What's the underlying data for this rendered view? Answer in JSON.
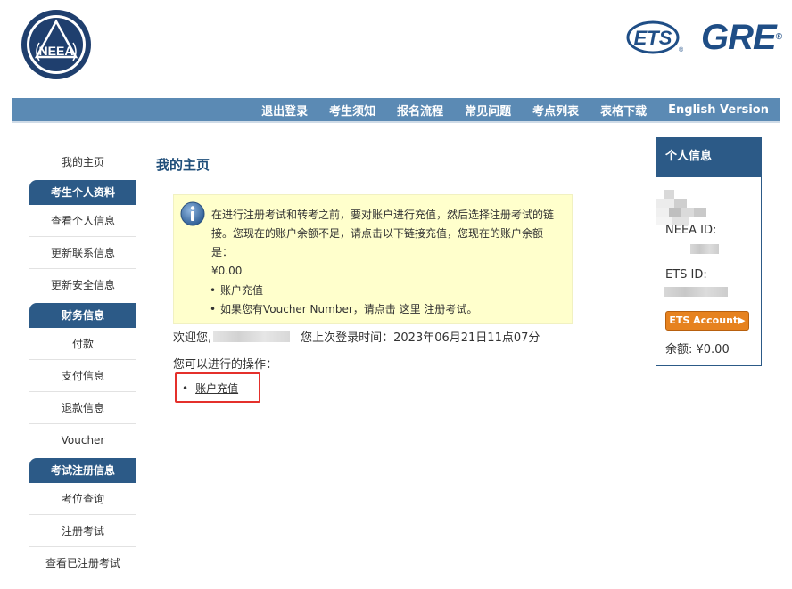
{
  "header": {
    "left_logo_text": "NEEA",
    "ets_logo_text": "ETS",
    "gre_logo_text": "GRE"
  },
  "nav": {
    "items": [
      "退出登录",
      "考生须知",
      "报名流程",
      "常见问题",
      "考点列表",
      "表格下载",
      "English Version"
    ]
  },
  "sidebar": {
    "home": "我的主页",
    "section_profile": "考生个人资料",
    "view_profile": "查看个人信息",
    "update_contact": "更新联系信息",
    "update_security": "更新安全信息",
    "section_finance": "财务信息",
    "pay": "付款",
    "payment_info": "支付信息",
    "refund_info": "退款信息",
    "voucher": "Voucher",
    "section_exam": "考试注册信息",
    "seat_query": "考位查询",
    "register_exam": "注册考试",
    "view_registered": "查看已注册考试"
  },
  "main": {
    "title": "我的主页",
    "notice": {
      "text": "在进行注册考试和转考之前，要对账户进行充值，然后选择注册考试的链接。您现在的账户余额不足，请点击以下链接充值，您现在的账户余额是：",
      "balance": "¥0.00",
      "bullet_1": "账户充值",
      "bullet_2": "如果您有Voucher Number，请点击 这里 注册考试。"
    },
    "welcome_prefix": "欢迎您,",
    "last_login": "您上次登录时间：2023年06月21日11点07分",
    "ops_label": "您可以进行的操作：",
    "action_link": "账户充值"
  },
  "panel": {
    "title": "个人信息",
    "neea_id_label": "NEEA ID:",
    "ets_id_label": "ETS ID:",
    "ets_button": "ETS Account",
    "balance": "余额: ¥0.00"
  },
  "colors": {
    "nav_bg": "#5b8ab4",
    "section_bg": "#2c5a87",
    "notice_bg": "#ffffcc",
    "highlight_border": "#e4302b",
    "ets_button_bg": "#e6821f"
  }
}
